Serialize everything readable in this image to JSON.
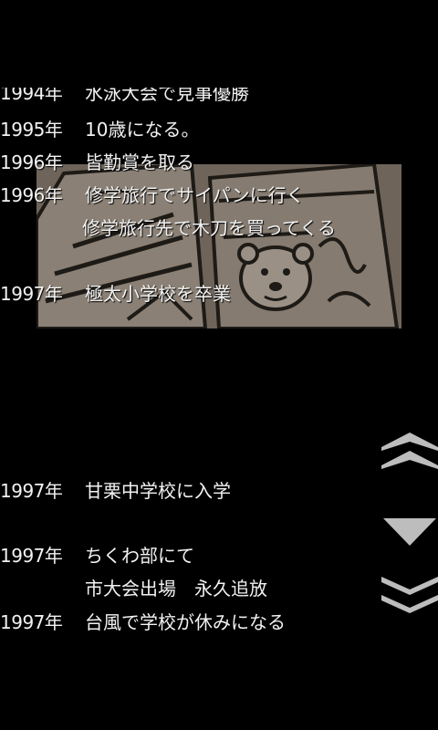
{
  "timeline": {
    "entries": [
      {
        "year": "1994年",
        "event": "水泳大会で見事優勝"
      },
      {
        "year": "1995年",
        "event": "10歳になる。"
      },
      {
        "year": "1996年",
        "event": "皆勤賞を取る"
      },
      {
        "year": "1996年",
        "event": "修学旅行でサイパンに行く"
      },
      {
        "year": "",
        "event": "修学旅行先で木刀を買ってくる"
      },
      {
        "year": "1997年",
        "event": "極太小学校を卒業"
      },
      {
        "year": "1997年",
        "event": "甘栗中学校に入学"
      },
      {
        "year": "1997年",
        "event": "ちくわ部にて"
      },
      {
        "year": "",
        "event": "市大会出場　永久追放"
      },
      {
        "year": "1997年",
        "event": "台風で学校が休みになる"
      }
    ]
  },
  "controls": {
    "page_up_icon": "double-chevron-up-icon",
    "scroll_down_icon": "triangle-down-icon",
    "page_down_icon": "double-chevron-down-icon",
    "icon_color": "#bdbdbd"
  },
  "colors": {
    "background": "#000000",
    "text": "#f2f2f2",
    "sketch_paper": "#6e645a",
    "sketch_ink": "#1e1a16"
  }
}
